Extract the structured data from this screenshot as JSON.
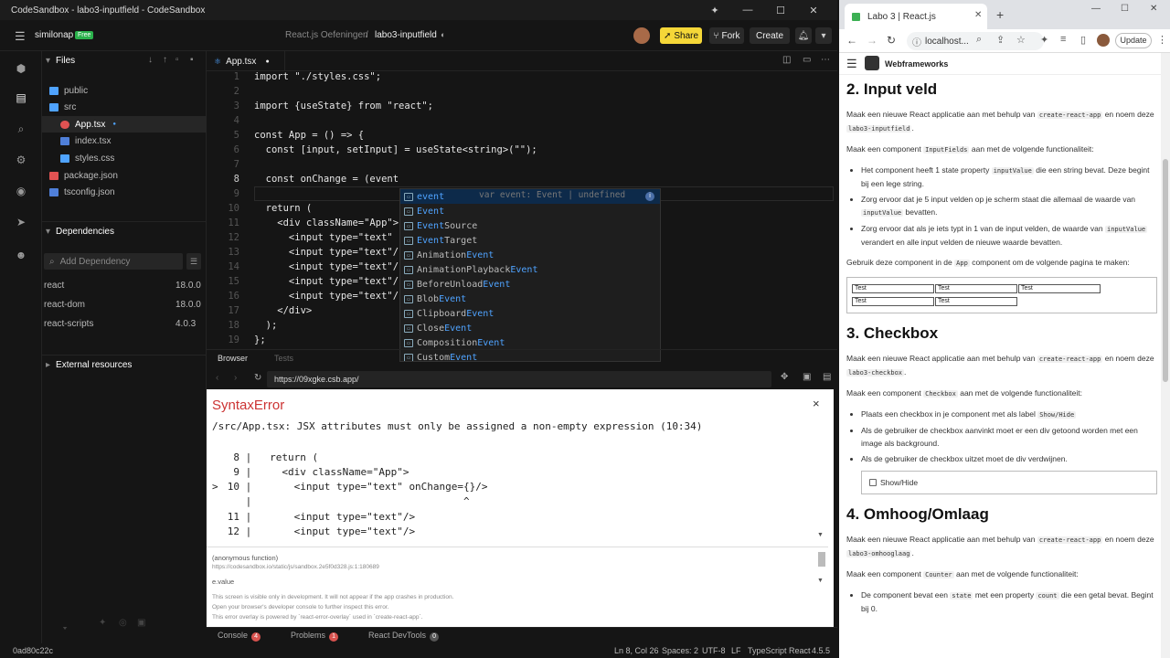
{
  "window": {
    "title": "CodeSandbox - labo3-inputfield - CodeSandbox"
  },
  "header": {
    "workspace": "similonap",
    "plan_badge": "Free",
    "breadcrumb_parent": "React.js Oefeningen",
    "breadcrumb_sep": "/",
    "sandbox_name": "labo3-inputfield",
    "share_label": "Share",
    "fork_label": "Fork",
    "create_label": "Create"
  },
  "explorer": {
    "files_title": "Files",
    "tree": [
      {
        "name": "public",
        "type": "folder"
      },
      {
        "name": "src",
        "type": "folder"
      },
      {
        "name": "App.tsx",
        "type": "file-react",
        "modified": true
      },
      {
        "name": "index.tsx",
        "type": "file-ts"
      },
      {
        "name": "styles.css",
        "type": "file-css"
      },
      {
        "name": "package.json",
        "type": "file-json"
      },
      {
        "name": "tsconfig.json",
        "type": "file-ts"
      }
    ],
    "deps_title": "Dependencies",
    "add_dep_placeholder": "Add Dependency",
    "deps": [
      {
        "name": "react",
        "version": "18.0.0"
      },
      {
        "name": "react-dom",
        "version": "18.0.0"
      },
      {
        "name": "react-scripts",
        "version": "4.0.3"
      }
    ],
    "external_title": "External resources"
  },
  "editor": {
    "tab_name": "App.tsx",
    "lines": [
      {
        "n": "1",
        "text": "import \"./styles.css\";"
      },
      {
        "n": "2",
        "text": ""
      },
      {
        "n": "3",
        "text": "import {useState} from \"react\";"
      },
      {
        "n": "4",
        "text": ""
      },
      {
        "n": "5",
        "text": "const App = () => {"
      },
      {
        "n": "6",
        "text": "  const [input, setInput] = useState<string>(\"\");"
      },
      {
        "n": "7",
        "text": ""
      },
      {
        "n": "8",
        "text": "  const onChange = (event"
      },
      {
        "n": "9",
        "text": ""
      },
      {
        "n": "10",
        "text": "  return ("
      },
      {
        "n": "11",
        "text": "    <div className=\"App\">"
      },
      {
        "n": "12",
        "text": "      <input type=\"text\""
      },
      {
        "n": "13",
        "text": "      <input type=\"text\"/"
      },
      {
        "n": "14",
        "text": "      <input type=\"text\"/"
      },
      {
        "n": "15",
        "text": "      <input type=\"text\"/"
      },
      {
        "n": "16",
        "text": "      <input type=\"text\"/"
      },
      {
        "n": "17",
        "text": "    </div>"
      },
      {
        "n": "18",
        "text": "  );"
      },
      {
        "n": "19",
        "text": "};"
      }
    ],
    "autocomplete": {
      "hint": "var event: Event | undefined",
      "items": [
        {
          "pre": "",
          "match": "event",
          "post": ""
        },
        {
          "pre": "",
          "match": "Event",
          "post": ""
        },
        {
          "pre": "",
          "match": "Event",
          "post": "Source"
        },
        {
          "pre": "",
          "match": "Event",
          "post": "Target"
        },
        {
          "pre": "Animation",
          "match": "Event",
          "post": ""
        },
        {
          "pre": "AnimationPlayback",
          "match": "Event",
          "post": ""
        },
        {
          "pre": "BeforeUnload",
          "match": "Event",
          "post": ""
        },
        {
          "pre": "Blob",
          "match": "Event",
          "post": ""
        },
        {
          "pre": "Clipboard",
          "match": "Event",
          "post": ""
        },
        {
          "pre": "Close",
          "match": "Event",
          "post": ""
        },
        {
          "pre": "Composition",
          "match": "Event",
          "post": ""
        },
        {
          "pre": "Custom",
          "match": "Event",
          "post": ""
        }
      ]
    }
  },
  "preview": {
    "tab_browser": "Browser",
    "tab_tests": "Tests",
    "url": "https://09xgke.csb.app/",
    "error_title": "SyntaxError",
    "error_message": "/src/App.tsx: JSX attributes must only be assigned a non-empty expression (10:34)",
    "error_lines": [
      {
        "marker": " ",
        "n": "8",
        "text": "  return ("
      },
      {
        "marker": " ",
        "n": "9",
        "text": "    <div className=\"App\">"
      },
      {
        "marker": ">",
        "n": "10",
        "text": "      <input type=\"text\" onChange={}/>"
      },
      {
        "marker": " ",
        "n": "",
        "text": "                                  ^"
      },
      {
        "marker": " ",
        "n": "11",
        "text": "      <input type=\"text\"/>"
      },
      {
        "marker": " ",
        "n": "12",
        "text": "      <input type=\"text\"/>"
      }
    ],
    "stack_fn": "(anonymous function)",
    "stack_url": "https://codesandbox.io/static/js/sandbox.2e5f0d328.js:1:180689",
    "stack_val": "e.value",
    "footer_1": "This screen is visible only in development. It will not appear if the app crashes in production.",
    "footer_2": "Open your browser's developer console to further inspect this error.",
    "footer_3": "This error overlay is powered by `react-error-overlay` used in `create-react-app`."
  },
  "bottom_tabs": [
    {
      "label": "Console",
      "count": "4",
      "color": "#d9534f"
    },
    {
      "label": "Problems",
      "count": "1",
      "color": "#d9534f"
    },
    {
      "label": "React DevTools",
      "count": "0",
      "color": "#555555"
    }
  ],
  "status": {
    "commit": "0ad80c22c",
    "position": "Ln 8, Col 26",
    "spaces": "Spaces: 2",
    "encoding": "UTF-8",
    "eol": "LF",
    "language": "TypeScript React",
    "version": "4.5.5"
  },
  "browser": {
    "tab_title": "Labo 3 | React.js",
    "address": "localhost...",
    "update_label": "Update",
    "site_title": "Webframeworks"
  },
  "doc": {
    "s2_title": "2. Input veld",
    "s2_p1a": "Maak een nieuwe React applicatie aan met behulp van",
    "s2_p1_code1": "create-react-app",
    "s2_p1b": "en noem deze",
    "s2_p1_code2": "labo3-inputfield",
    "s2_p2a": "Maak een component",
    "s2_p2_code": "InputFields",
    "s2_p2b": "aan met de volgende functionaliteit:",
    "s2_li1a": "Het component heeft 1 state property",
    "s2_li1_code": "inputValue",
    "s2_li1b": "die een string bevat. Deze begint bij een lege string.",
    "s2_li2a": "Zorg ervoor dat je 5 input velden op je scherm staat die allemaal de waarde van",
    "s2_li2_code": "inputValue",
    "s2_li2b": "bevatten.",
    "s2_li3a": "Zorg ervoor dat als je iets typt in 1 van de input velden, de waarde van",
    "s2_li3_code": "inputValue",
    "s2_li3b": "verandert en alle input velden de nieuwe waarde bevatten.",
    "s2_p3a": "Gebruik deze component in de",
    "s2_p3_code": "App",
    "s2_p3b": "component om de volgende pagina te maken:",
    "demo_value": "Test",
    "s3_title": "3. Checkbox",
    "s3_p1a": "Maak een nieuwe React applicatie aan met behulp van",
    "s3_p1_code1": "create-react-app",
    "s3_p1b": "en noem deze",
    "s3_p1_code2": "labo3-checkbox",
    "s3_p2a": "Maak een component",
    "s3_p2_code": "Checkbox",
    "s3_p2b": "aan met de volgende functionaliteit:",
    "s3_li1a": "Plaats een checkbox in je component met als label",
    "s3_li1_code": "Show/Hide",
    "s3_li2": "Als de gebruiker de checkbox aanvinkt moet er een div getoond worden met een image als background.",
    "s3_li3": "Als de gebruiker de checkbox uitzet moet de div verdwijnen.",
    "s3_demo_label": "Show/Hide",
    "s4_title": "4. Omhoog/Omlaag",
    "s4_p1a": "Maak een nieuwe React applicatie aan met behulp van",
    "s4_p1_code1": "create-react-app",
    "s4_p1b": "en noem deze",
    "s4_p1_code2": "labo3-omhooglaag",
    "s4_p2a": "Maak een component",
    "s4_p2_code": "Counter",
    "s4_p2b": "aan met de volgende functionaliteit:",
    "s4_li1a": "De component bevat een",
    "s4_li1_code1": "state",
    "s4_li1b": "met een property",
    "s4_li1_code2": "count",
    "s4_li1c": "die een getal bevat. Begint bij 0."
  }
}
